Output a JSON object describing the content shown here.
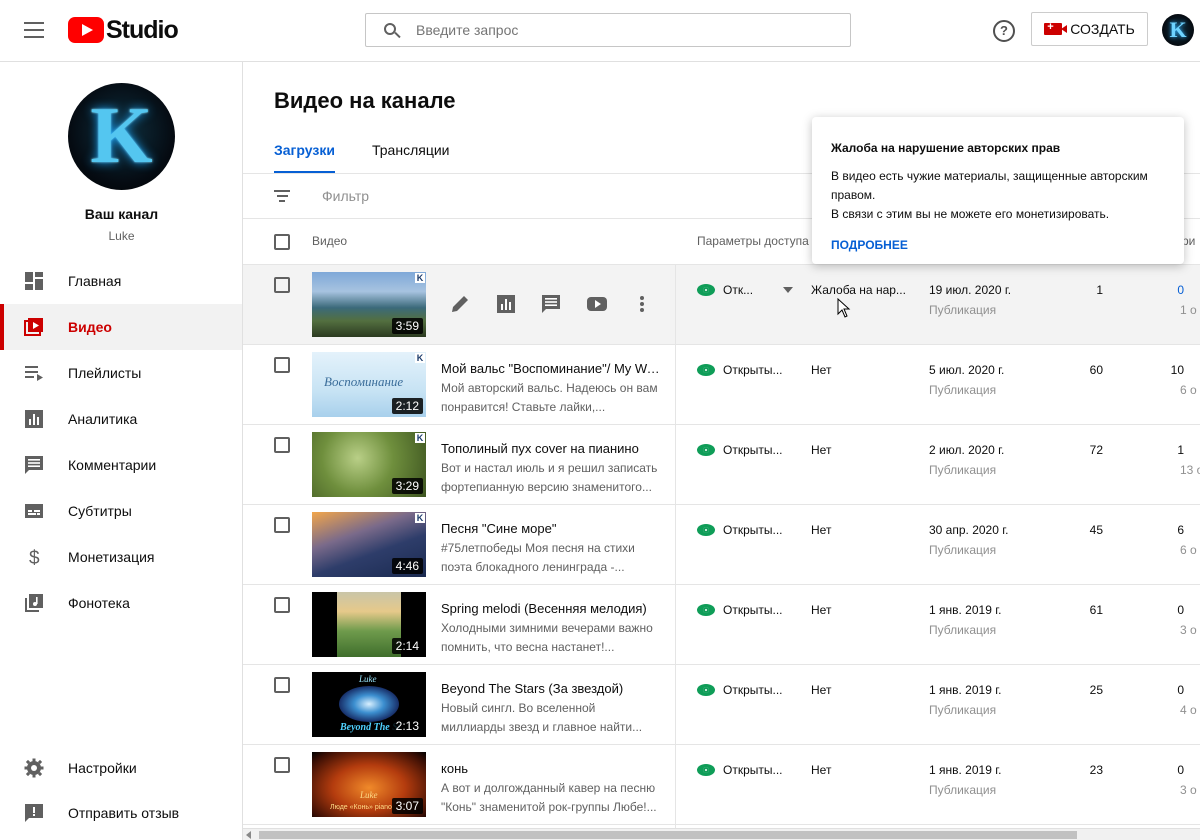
{
  "app": {
    "logo_text": "Studio"
  },
  "search": {
    "placeholder": "Введите запрос"
  },
  "header": {
    "create_label": "СОЗДАТЬ",
    "help_label": "?",
    "avatar_letter": "K"
  },
  "channel": {
    "avatar_letter": "K",
    "title": "Ваш канал",
    "subtitle": "Luke"
  },
  "sidebar": {
    "items": [
      {
        "label": "Главная",
        "icon": "dashboard-icon"
      },
      {
        "label": "Видео",
        "icon": "video-icon",
        "active": true
      },
      {
        "label": "Плейлисты",
        "icon": "playlist-icon"
      },
      {
        "label": "Аналитика",
        "icon": "analytics-icon"
      },
      {
        "label": "Комментарии",
        "icon": "comments-icon"
      },
      {
        "label": "Субтитры",
        "icon": "subtitles-icon"
      },
      {
        "label": "Монетизация",
        "icon": "dollar-icon"
      },
      {
        "label": "Фонотека",
        "icon": "audio-library-icon"
      }
    ],
    "bottom": [
      {
        "label": "Настройки",
        "icon": "gear-icon"
      },
      {
        "label": "Отправить отзыв",
        "icon": "feedback-icon"
      }
    ]
  },
  "main": {
    "title": "Видео на канале",
    "tabs": [
      {
        "label": "Загрузки",
        "active": true
      },
      {
        "label": "Трансляции"
      }
    ],
    "filter_placeholder": "Фильтр",
    "columns": {
      "video": "Видео",
      "visibility": "Параметры доступа",
      "extra": "ри"
    }
  },
  "popover": {
    "title": "Жалоба на нарушение авторских прав",
    "line1": "В видео есть чужие материалы, защищенные авторским",
    "line2": "правом.",
    "line3": "В связи с этим вы не можете его монетизировать.",
    "link": "ПОДРОБНЕЕ"
  },
  "videos": [
    {
      "title": "",
      "desc1": "",
      "desc2": "",
      "duration": "3:59",
      "visibility": "Отк...",
      "restriction": "Жалоба на нар...",
      "date": "19 июл. 2020 г.",
      "date_type": "Публикация",
      "views": "1",
      "comments": "0",
      "likes": "1 о",
      "hover": true
    },
    {
      "title": "Мой вальс \"Воспоминание\"/ My Wal...",
      "desc1": "Мой авторский вальс. Надеюсь он вам",
      "desc2": "понравится! Ставьте лайки,...",
      "duration": "2:12",
      "visibility": "Открыты...",
      "restriction": "Нет",
      "date": "5 июл. 2020 г.",
      "date_type": "Публикация",
      "views": "60",
      "comments": "10",
      "likes": "6 о"
    },
    {
      "title": "Тополиный пух cover на пианино",
      "desc1": "Вот и настал июль и я решил записать",
      "desc2": "фортепианную версию знаменитого...",
      "duration": "3:29",
      "visibility": "Открыты...",
      "restriction": "Нет",
      "date": "2 июл. 2020 г.",
      "date_type": "Публикация",
      "views": "72",
      "comments": "1",
      "likes": "13 о"
    },
    {
      "title": "Песня \"Сине море\"",
      "desc1": "#75летпобеды Моя песня на стихи",
      "desc2": "поэта блокадного ленинграда -...",
      "duration": "4:46",
      "visibility": "Открыты...",
      "restriction": "Нет",
      "date": "30 апр. 2020 г.",
      "date_type": "Публикация",
      "views": "45",
      "comments": "6",
      "likes": "6 о"
    },
    {
      "title": "Spring melodi (Весенняя мелодия)",
      "desc1": "Холодными зимними вечерами важно",
      "desc2": "помнить, что весна настанет!...",
      "duration": "2:14",
      "visibility": "Открыты...",
      "restriction": "Нет",
      "date": "1 янв. 2019 г.",
      "date_type": "Публикация",
      "views": "61",
      "comments": "0",
      "likes": "3 о"
    },
    {
      "title": "Beyond The Stars (За звездой)",
      "desc1": "Новый сингл. Во вселенной",
      "desc2": "миллиарды звезд и главное найти...",
      "duration": "2:13",
      "visibility": "Открыты...",
      "restriction": "Нет",
      "date": "1 янв. 2019 г.",
      "date_type": "Публикация",
      "views": "25",
      "comments": "0",
      "likes": "4 о"
    },
    {
      "title": "конь",
      "desc1": "А вот и долгожданный кавер на песню",
      "desc2": "\"Конь\" знаменитой рок-группы Любе!...",
      "duration": "3:07",
      "visibility": "Открыты...",
      "restriction": "Нет",
      "date": "1 янв. 2019 г.",
      "date_type": "Публикация",
      "views": "23",
      "comments": "0",
      "likes": "3 о"
    }
  ],
  "thumb_labels": {
    "v2": "Воспоминание",
    "v6": "Beyond The St",
    "v6_top": "Luke",
    "v7": "Люде «Конь» piano",
    "v7_top": "Luke"
  },
  "colors": {
    "accent": "#065fd4",
    "brand_red": "#cc0000",
    "visibility_green": "#0f9d58"
  }
}
